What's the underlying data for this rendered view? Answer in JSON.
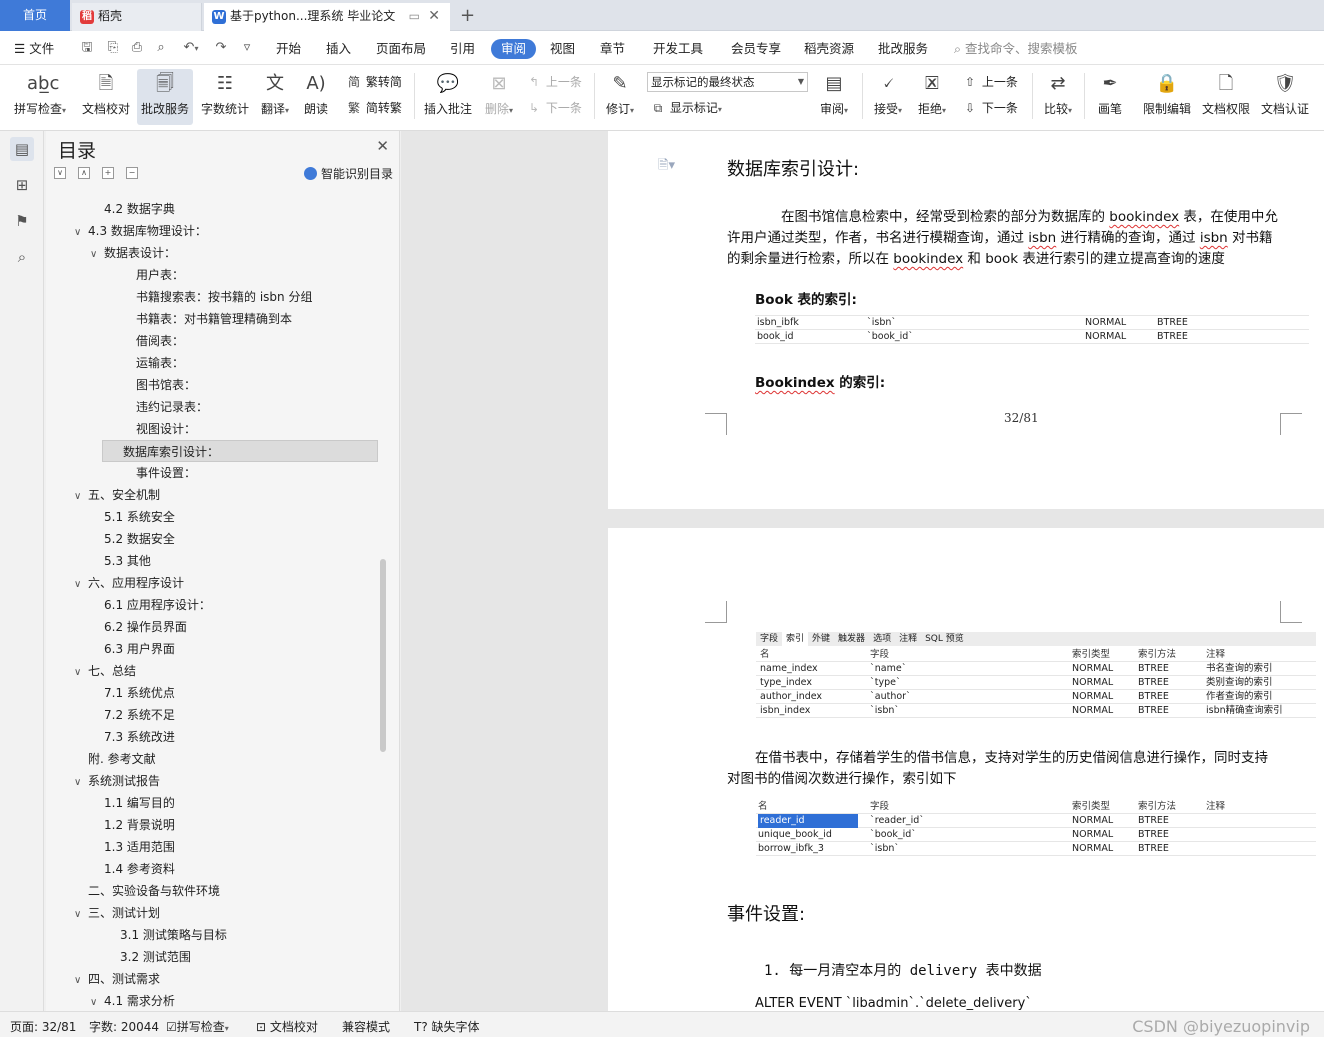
{
  "tabs": {
    "home": "首页",
    "daoke": "稻壳",
    "doc": "基于python...理系统 毕业论文",
    "new_tab": "+",
    "close": "✕"
  },
  "menu": {
    "file": "文件",
    "items": [
      "开始",
      "插入",
      "页面布局",
      "引用",
      "审阅",
      "视图",
      "章节",
      "开发工具",
      "会员专享",
      "稻壳资源",
      "批改服务"
    ],
    "search_placeholder": "查找命令、搜索模板"
  },
  "toolbar": {
    "spell": "拼写检查",
    "proofread": "文档校对",
    "revise_service": "批改服务",
    "word_count": "字数统计",
    "translate": "翻译",
    "read_aloud": "朗读",
    "trad_to_simp": "繁转简",
    "simp_to_trad": "简转繁",
    "insert_comment": "插入批注",
    "delete": "删除",
    "prev": "上一条",
    "next": "下一条",
    "track": "修订",
    "markup_state": "显示标记的最终状态",
    "show_markup": "显示标记",
    "review": "审阅",
    "accept": "接受",
    "reject": "拒绝",
    "prev2": "上一条",
    "next2": "下一条",
    "compare": "比较",
    "pen": "画笔",
    "restrict_edit": "限制编辑",
    "doc_permission": "文档权限",
    "doc_auth": "文档认证"
  },
  "nav": {
    "title": "目录",
    "smart": "智能识别目录",
    "items": [
      {
        "text": "4.2  数据字典",
        "caret": ""
      },
      {
        "text": "4.3 数据库物理设计：",
        "caret": "∨"
      },
      {
        "text": "数据表设计：",
        "caret": "∨"
      },
      {
        "text": "用户表：",
        "caret": ""
      },
      {
        "text": "书籍搜索表：按书籍的 isbn 分组",
        "caret": ""
      },
      {
        "text": "书籍表：对书籍管理精确到本",
        "caret": ""
      },
      {
        "text": "借阅表：",
        "caret": ""
      },
      {
        "text": "运输表：",
        "caret": ""
      },
      {
        "text": "图书馆表：",
        "caret": ""
      },
      {
        "text": "违约记录表：",
        "caret": ""
      },
      {
        "text": "视图设计：",
        "caret": ""
      },
      {
        "text": "数据库索引设计：",
        "caret": ""
      },
      {
        "text": "事件设置：",
        "caret": ""
      },
      {
        "text": "五、安全机制",
        "caret": "∨"
      },
      {
        "text": "5.1  系统安全",
        "caret": ""
      },
      {
        "text": "5.2  数据安全",
        "caret": ""
      },
      {
        "text": "5.3  其他",
        "caret": ""
      },
      {
        "text": "六、应用程序设计",
        "caret": "∨"
      },
      {
        "text": "6.1 应用程序设计：",
        "caret": ""
      },
      {
        "text": "6.2 操作员界面",
        "caret": ""
      },
      {
        "text": "6.3 用户界面",
        "caret": ""
      },
      {
        "text": "七、总结",
        "caret": "∨"
      },
      {
        "text": "7.1  系统优点",
        "caret": ""
      },
      {
        "text": "7.2  系统不足",
        "caret": ""
      },
      {
        "text": "7.3  系统改进",
        "caret": ""
      },
      {
        "text": "附. 参考文献",
        "caret": ""
      },
      {
        "text": "系统测试报告",
        "caret": "∨"
      },
      {
        "text": "1.1  编写目的",
        "caret": ""
      },
      {
        "text": "1.2  背景说明",
        "caret": ""
      },
      {
        "text": "1.3  适用范围",
        "caret": ""
      },
      {
        "text": "1.4  参考资料",
        "caret": ""
      },
      {
        "text": "二、实验设备与软件环境",
        "caret": ""
      },
      {
        "text": "三、测试计划",
        "caret": "∨"
      },
      {
        "text": "3.1 测试策略与目标",
        "caret": ""
      },
      {
        "text": "3.2 测试范围",
        "caret": ""
      },
      {
        "text": "四、测试需求",
        "caret": "∨"
      },
      {
        "text": "4.1  需求分析",
        "caret": "∨"
      }
    ]
  },
  "doc": {
    "heading1": "数据库索引设计:",
    "para1_a": "在图书馆信息检索中，经常受到检索的部分为数据库的 ",
    "para1_w1": "bookindex",
    "para1_b": " 表，在使用中允",
    "para1_c": "许用户通过类型，作者，书名进行模糊查询，通过 ",
    "para1_w2": "isbn",
    "para1_d": " 进行精确的查询，通过 ",
    "para1_w3": "isbn",
    "para1_e": " 对书籍",
    "para1_f": "的剩余量进行检索，所以在 ",
    "para1_w4": "bookindex",
    "para1_g": " 和 book 表进行索引的建立提高查询的速度",
    "book_index_title": "Book 表的索引:",
    "book_rows": [
      [
        "isbn_ibfk",
        "`isbn`",
        "NORMAL",
        "BTREE"
      ],
      [
        "book_id",
        "`book_id`",
        "NORMAL",
        "BTREE"
      ]
    ],
    "bookindex_title_w": "Bookindex",
    "bookindex_title_rest": " 的索引:",
    "page_number": "32/81",
    "strip_tabs": [
      "字段",
      "索引",
      "外键",
      "触发器",
      "选项",
      "注释",
      "SQL 预览"
    ],
    "t2_head": [
      "名",
      "字段",
      "索引类型",
      "索引方法",
      "注释"
    ],
    "t2_rows": [
      [
        "name_index",
        "`name`",
        "NORMAL",
        "BTREE",
        "书名查询的索引"
      ],
      [
        "type_index",
        "`type`",
        "NORMAL",
        "BTREE",
        "类别查询的索引"
      ],
      [
        "author_index",
        "`author`",
        "NORMAL",
        "BTREE",
        "作者查询的索引"
      ],
      [
        "isbn_index",
        "`isbn`",
        "NORMAL",
        "BTREE",
        "isbn精确查询索引"
      ]
    ],
    "para2_a": "在借书表中，存储着学生的借书信息，支持对学生的历史借阅信息进行操作，同时支持",
    "para2_b": "对图书的借阅次数进行操作，索引如下",
    "t3_head": [
      "名",
      "字段",
      "索引类型",
      "索引方法",
      "注释"
    ],
    "t3_rows": [
      [
        "reader_id",
        "`reader_id`",
        "NORMAL",
        "BTREE",
        ""
      ],
      [
        "unique_book_id",
        "`book_id`",
        "NORMAL",
        "BTREE",
        ""
      ],
      [
        "borrow_ibfk_3",
        "`isbn`",
        "NORMAL",
        "BTREE",
        ""
      ]
    ],
    "heading2": "事件设置:",
    "item1": "1. 每一月清空本月的 delivery 表中数据",
    "sql": "ALTER EVENT `libadmin`.`delete_delivery`"
  },
  "status": {
    "page": "页面: 32/81",
    "words": "字数: 20044",
    "spell": "拼写检查",
    "proof": "文档校对",
    "compat": "兼容模式",
    "missing_font": "缺失字体",
    "watermark": "CSDN @biyezuopinvip"
  },
  "colors": {
    "accent": "#3f7ad8"
  }
}
